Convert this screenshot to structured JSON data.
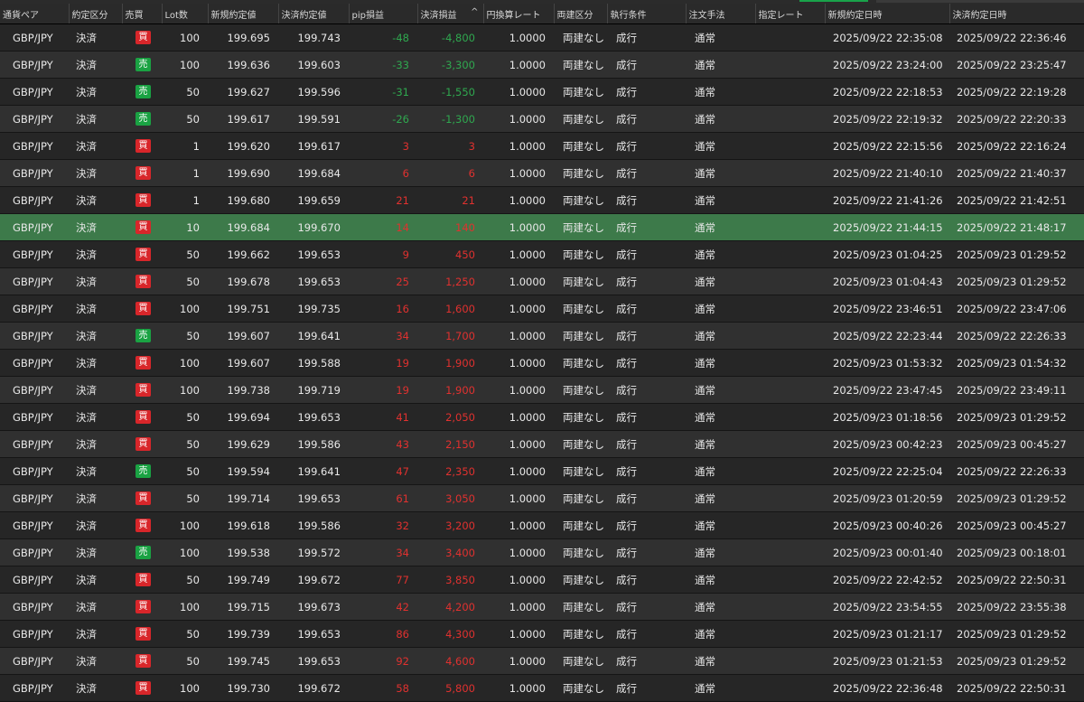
{
  "colors": {
    "buy_badge": "#d8262a",
    "sell_badge": "#1aa243",
    "profit_text": "#e0312f",
    "loss_text": "#2fa84f",
    "selected_row": "#3d7a4a"
  },
  "table": {
    "headers": {
      "pair": "通貨ペア",
      "kbn": "約定区分",
      "side": "売買",
      "lot": "Lot数",
      "open_rate": "新規約定値",
      "close_rate": "決済約定値",
      "pip": "pip損益",
      "pl": "決済損益",
      "yen_rate": "円換算レート",
      "hedge": "両建区分",
      "exec": "執行条件",
      "method": "注文手法",
      "limit_rate": "指定レート",
      "open_time": "新規約定日時",
      "close_time": "決済約定日時"
    },
    "sort_indicator": "^",
    "selected_index": 7,
    "rows": [
      {
        "pair": "GBP/JPY",
        "kbn": "決済",
        "side": "買",
        "lot": "100",
        "open_rate": "199.695",
        "close_rate": "199.743",
        "pip": "-48",
        "pl": "-4,800",
        "yen_rate": "1.0000",
        "hedge": "両建なし",
        "exec": "成行",
        "method": "通常",
        "limit_rate": "",
        "open_time": "2025/09/22 22:35:08",
        "close_time": "2025/09/22 22:36:46"
      },
      {
        "pair": "GBP/JPY",
        "kbn": "決済",
        "side": "売",
        "lot": "100",
        "open_rate": "199.636",
        "close_rate": "199.603",
        "pip": "-33",
        "pl": "-3,300",
        "yen_rate": "1.0000",
        "hedge": "両建なし",
        "exec": "成行",
        "method": "通常",
        "limit_rate": "",
        "open_time": "2025/09/22 23:24:00",
        "close_time": "2025/09/22 23:25:47"
      },
      {
        "pair": "GBP/JPY",
        "kbn": "決済",
        "side": "売",
        "lot": "50",
        "open_rate": "199.627",
        "close_rate": "199.596",
        "pip": "-31",
        "pl": "-1,550",
        "yen_rate": "1.0000",
        "hedge": "両建なし",
        "exec": "成行",
        "method": "通常",
        "limit_rate": "",
        "open_time": "2025/09/22 22:18:53",
        "close_time": "2025/09/22 22:19:28"
      },
      {
        "pair": "GBP/JPY",
        "kbn": "決済",
        "side": "売",
        "lot": "50",
        "open_rate": "199.617",
        "close_rate": "199.591",
        "pip": "-26",
        "pl": "-1,300",
        "yen_rate": "1.0000",
        "hedge": "両建なし",
        "exec": "成行",
        "method": "通常",
        "limit_rate": "",
        "open_time": "2025/09/22 22:19:32",
        "close_time": "2025/09/22 22:20:33"
      },
      {
        "pair": "GBP/JPY",
        "kbn": "決済",
        "side": "買",
        "lot": "1",
        "open_rate": "199.620",
        "close_rate": "199.617",
        "pip": "3",
        "pl": "3",
        "yen_rate": "1.0000",
        "hedge": "両建なし",
        "exec": "成行",
        "method": "通常",
        "limit_rate": "",
        "open_time": "2025/09/22 22:15:56",
        "close_time": "2025/09/22 22:16:24"
      },
      {
        "pair": "GBP/JPY",
        "kbn": "決済",
        "side": "買",
        "lot": "1",
        "open_rate": "199.690",
        "close_rate": "199.684",
        "pip": "6",
        "pl": "6",
        "yen_rate": "1.0000",
        "hedge": "両建なし",
        "exec": "成行",
        "method": "通常",
        "limit_rate": "",
        "open_time": "2025/09/22 21:40:10",
        "close_time": "2025/09/22 21:40:37"
      },
      {
        "pair": "GBP/JPY",
        "kbn": "決済",
        "side": "買",
        "lot": "1",
        "open_rate": "199.680",
        "close_rate": "199.659",
        "pip": "21",
        "pl": "21",
        "yen_rate": "1.0000",
        "hedge": "両建なし",
        "exec": "成行",
        "method": "通常",
        "limit_rate": "",
        "open_time": "2025/09/22 21:41:26",
        "close_time": "2025/09/22 21:42:51"
      },
      {
        "pair": "GBP/JPY",
        "kbn": "決済",
        "side": "買",
        "lot": "10",
        "open_rate": "199.684",
        "close_rate": "199.670",
        "pip": "14",
        "pl": "140",
        "yen_rate": "1.0000",
        "hedge": "両建なし",
        "exec": "成行",
        "method": "通常",
        "limit_rate": "",
        "open_time": "2025/09/22 21:44:15",
        "close_time": "2025/09/22 21:48:17"
      },
      {
        "pair": "GBP/JPY",
        "kbn": "決済",
        "side": "買",
        "lot": "50",
        "open_rate": "199.662",
        "close_rate": "199.653",
        "pip": "9",
        "pl": "450",
        "yen_rate": "1.0000",
        "hedge": "両建なし",
        "exec": "成行",
        "method": "通常",
        "limit_rate": "",
        "open_time": "2025/09/23 01:04:25",
        "close_time": "2025/09/23 01:29:52"
      },
      {
        "pair": "GBP/JPY",
        "kbn": "決済",
        "side": "買",
        "lot": "50",
        "open_rate": "199.678",
        "close_rate": "199.653",
        "pip": "25",
        "pl": "1,250",
        "yen_rate": "1.0000",
        "hedge": "両建なし",
        "exec": "成行",
        "method": "通常",
        "limit_rate": "",
        "open_time": "2025/09/23 01:04:43",
        "close_time": "2025/09/23 01:29:52"
      },
      {
        "pair": "GBP/JPY",
        "kbn": "決済",
        "side": "買",
        "lot": "100",
        "open_rate": "199.751",
        "close_rate": "199.735",
        "pip": "16",
        "pl": "1,600",
        "yen_rate": "1.0000",
        "hedge": "両建なし",
        "exec": "成行",
        "method": "通常",
        "limit_rate": "",
        "open_time": "2025/09/22 23:46:51",
        "close_time": "2025/09/22 23:47:06"
      },
      {
        "pair": "GBP/JPY",
        "kbn": "決済",
        "side": "売",
        "lot": "50",
        "open_rate": "199.607",
        "close_rate": "199.641",
        "pip": "34",
        "pl": "1,700",
        "yen_rate": "1.0000",
        "hedge": "両建なし",
        "exec": "成行",
        "method": "通常",
        "limit_rate": "",
        "open_time": "2025/09/22 22:23:44",
        "close_time": "2025/09/22 22:26:33"
      },
      {
        "pair": "GBP/JPY",
        "kbn": "決済",
        "side": "買",
        "lot": "100",
        "open_rate": "199.607",
        "close_rate": "199.588",
        "pip": "19",
        "pl": "1,900",
        "yen_rate": "1.0000",
        "hedge": "両建なし",
        "exec": "成行",
        "method": "通常",
        "limit_rate": "",
        "open_time": "2025/09/23 01:53:32",
        "close_time": "2025/09/23 01:54:32"
      },
      {
        "pair": "GBP/JPY",
        "kbn": "決済",
        "side": "買",
        "lot": "100",
        "open_rate": "199.738",
        "close_rate": "199.719",
        "pip": "19",
        "pl": "1,900",
        "yen_rate": "1.0000",
        "hedge": "両建なし",
        "exec": "成行",
        "method": "通常",
        "limit_rate": "",
        "open_time": "2025/09/22 23:47:45",
        "close_time": "2025/09/22 23:49:11"
      },
      {
        "pair": "GBP/JPY",
        "kbn": "決済",
        "side": "買",
        "lot": "50",
        "open_rate": "199.694",
        "close_rate": "199.653",
        "pip": "41",
        "pl": "2,050",
        "yen_rate": "1.0000",
        "hedge": "両建なし",
        "exec": "成行",
        "method": "通常",
        "limit_rate": "",
        "open_time": "2025/09/23 01:18:56",
        "close_time": "2025/09/23 01:29:52"
      },
      {
        "pair": "GBP/JPY",
        "kbn": "決済",
        "side": "買",
        "lot": "50",
        "open_rate": "199.629",
        "close_rate": "199.586",
        "pip": "43",
        "pl": "2,150",
        "yen_rate": "1.0000",
        "hedge": "両建なし",
        "exec": "成行",
        "method": "通常",
        "limit_rate": "",
        "open_time": "2025/09/23 00:42:23",
        "close_time": "2025/09/23 00:45:27"
      },
      {
        "pair": "GBP/JPY",
        "kbn": "決済",
        "side": "売",
        "lot": "50",
        "open_rate": "199.594",
        "close_rate": "199.641",
        "pip": "47",
        "pl": "2,350",
        "yen_rate": "1.0000",
        "hedge": "両建なし",
        "exec": "成行",
        "method": "通常",
        "limit_rate": "",
        "open_time": "2025/09/22 22:25:04",
        "close_time": "2025/09/22 22:26:33"
      },
      {
        "pair": "GBP/JPY",
        "kbn": "決済",
        "side": "買",
        "lot": "50",
        "open_rate": "199.714",
        "close_rate": "199.653",
        "pip": "61",
        "pl": "3,050",
        "yen_rate": "1.0000",
        "hedge": "両建なし",
        "exec": "成行",
        "method": "通常",
        "limit_rate": "",
        "open_time": "2025/09/23 01:20:59",
        "close_time": "2025/09/23 01:29:52"
      },
      {
        "pair": "GBP/JPY",
        "kbn": "決済",
        "side": "買",
        "lot": "100",
        "open_rate": "199.618",
        "close_rate": "199.586",
        "pip": "32",
        "pl": "3,200",
        "yen_rate": "1.0000",
        "hedge": "両建なし",
        "exec": "成行",
        "method": "通常",
        "limit_rate": "",
        "open_time": "2025/09/23 00:40:26",
        "close_time": "2025/09/23 00:45:27"
      },
      {
        "pair": "GBP/JPY",
        "kbn": "決済",
        "side": "売",
        "lot": "100",
        "open_rate": "199.538",
        "close_rate": "199.572",
        "pip": "34",
        "pl": "3,400",
        "yen_rate": "1.0000",
        "hedge": "両建なし",
        "exec": "成行",
        "method": "通常",
        "limit_rate": "",
        "open_time": "2025/09/23 00:01:40",
        "close_time": "2025/09/23 00:18:01"
      },
      {
        "pair": "GBP/JPY",
        "kbn": "決済",
        "side": "買",
        "lot": "50",
        "open_rate": "199.749",
        "close_rate": "199.672",
        "pip": "77",
        "pl": "3,850",
        "yen_rate": "1.0000",
        "hedge": "両建なし",
        "exec": "成行",
        "method": "通常",
        "limit_rate": "",
        "open_time": "2025/09/22 22:42:52",
        "close_time": "2025/09/22 22:50:31"
      },
      {
        "pair": "GBP/JPY",
        "kbn": "決済",
        "side": "買",
        "lot": "100",
        "open_rate": "199.715",
        "close_rate": "199.673",
        "pip": "42",
        "pl": "4,200",
        "yen_rate": "1.0000",
        "hedge": "両建なし",
        "exec": "成行",
        "method": "通常",
        "limit_rate": "",
        "open_time": "2025/09/22 23:54:55",
        "close_time": "2025/09/22 23:55:38"
      },
      {
        "pair": "GBP/JPY",
        "kbn": "決済",
        "side": "買",
        "lot": "50",
        "open_rate": "199.739",
        "close_rate": "199.653",
        "pip": "86",
        "pl": "4,300",
        "yen_rate": "1.0000",
        "hedge": "両建なし",
        "exec": "成行",
        "method": "通常",
        "limit_rate": "",
        "open_time": "2025/09/23 01:21:17",
        "close_time": "2025/09/23 01:29:52"
      },
      {
        "pair": "GBP/JPY",
        "kbn": "決済",
        "side": "買",
        "lot": "50",
        "open_rate": "199.745",
        "close_rate": "199.653",
        "pip": "92",
        "pl": "4,600",
        "yen_rate": "1.0000",
        "hedge": "両建なし",
        "exec": "成行",
        "method": "通常",
        "limit_rate": "",
        "open_time": "2025/09/23 01:21:53",
        "close_time": "2025/09/23 01:29:52"
      },
      {
        "pair": "GBP/JPY",
        "kbn": "決済",
        "side": "買",
        "lot": "100",
        "open_rate": "199.730",
        "close_rate": "199.672",
        "pip": "58",
        "pl": "5,800",
        "yen_rate": "1.0000",
        "hedge": "両建なし",
        "exec": "成行",
        "method": "通常",
        "limit_rate": "",
        "open_time": "2025/09/22 22:36:48",
        "close_time": "2025/09/22 22:50:31"
      }
    ]
  }
}
